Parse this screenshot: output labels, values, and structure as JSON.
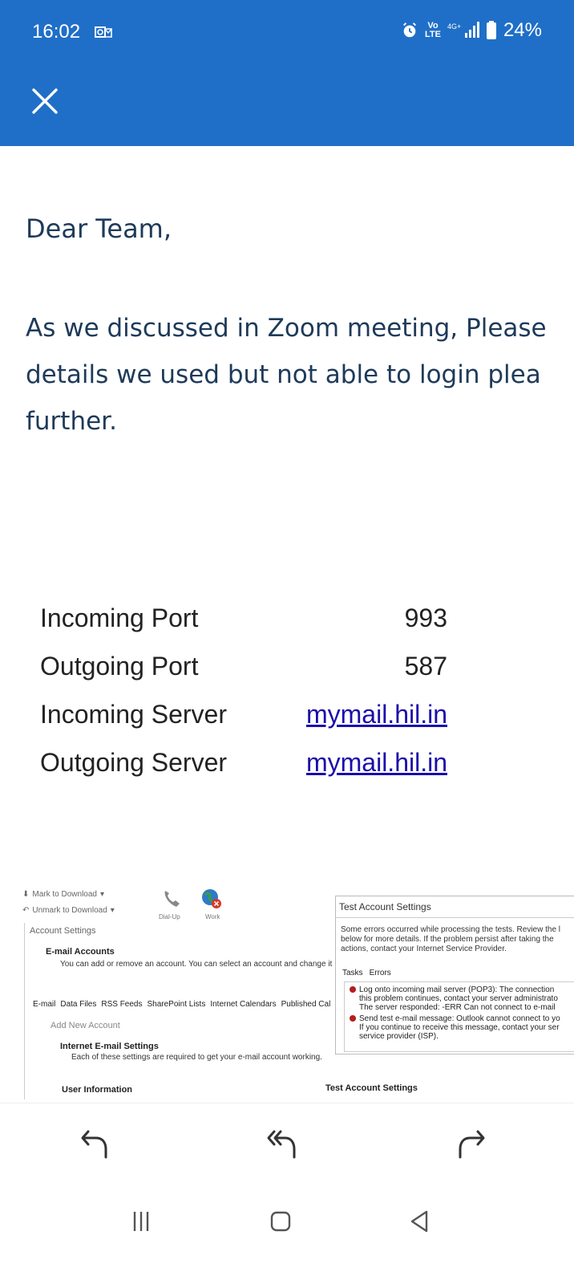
{
  "status_bar": {
    "time": "16:02",
    "volte": "Vo\nLTE",
    "network": "4G+",
    "battery": "24%"
  },
  "email": {
    "greeting": "Dear Team,",
    "paragraph_lines": [
      "As we discussed in Zoom meeting, Please",
      "details we used but not able to login plea",
      "further."
    ],
    "settings": [
      {
        "label": "Incoming Port",
        "value": "993",
        "is_link": false
      },
      {
        "label": "Outgoing Port",
        "value": "587",
        "is_link": false
      },
      {
        "label": "Incoming Server",
        "value": "mymail.hil.in",
        "is_link": true
      },
      {
        "label": "Outgoing Server",
        "value": "mymail.hil.in",
        "is_link": true
      }
    ]
  },
  "attachment": {
    "toolbar": {
      "mark": "Mark to Download",
      "unmark": "Unmark to Download",
      "dialup": "Dial-Up",
      "work": "Work"
    },
    "account_settings": {
      "title": "Account Settings",
      "email_accounts_title": "E-mail Accounts",
      "email_accounts_desc": "You can add or remove an account. You can select an account and change it",
      "tabs": [
        "E-mail",
        "Data Files",
        "RSS Feeds",
        "SharePoint Lists",
        "Internet Calendars",
        "Published Cal"
      ],
      "add_new": "Add New Account",
      "inet_title": "Internet E-mail Settings",
      "inet_desc": "Each of these settings are required to get your e-mail account working.",
      "user_info": "User Information"
    },
    "test_settings": {
      "title": "Test Account Settings",
      "message_lines": [
        "Some errors occurred while processing the tests. Review the l",
        "below for more details. If the problem persist after taking the",
        "actions, contact your Internet Service Provider."
      ],
      "tabs": [
        "Tasks",
        "Errors"
      ],
      "errors": [
        [
          "Log onto incoming mail server (POP3): The connection",
          "this problem continues, contact your server administrato",
          "The server responded: -ERR Can not connect to e-mail"
        ],
        [
          "Send test e-mail message: Outlook cannot connect to yo",
          "If you continue to receive this message, contact your ser",
          "service provider (ISP)."
        ]
      ],
      "bottom_label": "Test Account Settings"
    }
  }
}
